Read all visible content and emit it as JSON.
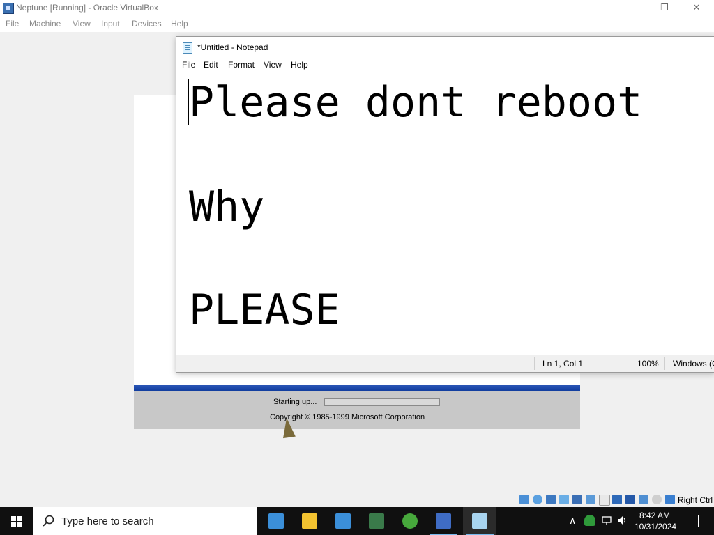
{
  "vbox": {
    "title": "Neptune [Running] - Oracle VirtualBox",
    "window_controls": {
      "minimize": "—",
      "restore": "❐",
      "close": "✕"
    },
    "menu": [
      "File",
      "Machine",
      "View",
      "Input",
      "Devices",
      "Help"
    ],
    "status_icons": [
      "hard-disk-icon",
      "optical-drive-icon",
      "floppy-icon",
      "audio-icon",
      "network-icon",
      "usb-icon",
      "shared-folders-icon",
      "display-icon",
      "recording-icon",
      "cpu-icon",
      "mouse-integration-icon",
      "keyboard-icon"
    ],
    "host_key": "Right Ctrl"
  },
  "splash": {
    "status_text": "Starting up...",
    "progress": 0,
    "copyright": "Copyright © 1985-1999  Microsoft Corporation",
    "bar_color": "#1a47aa"
  },
  "notepad": {
    "title": "*Untitled - Notepad",
    "menu": [
      "File",
      "Edit",
      "Format",
      "View",
      "Help"
    ],
    "lines": [
      "Please dont reboot",
      "Why",
      "PLEASE"
    ],
    "status": {
      "position": "Ln 1, Col 1",
      "zoom": "100%",
      "encoding": "Windows (C"
    }
  },
  "taskbar": {
    "search_placeholder": "Type here to search",
    "apps": [
      {
        "name": "virtualbox-icon",
        "color": "#3b8fd9"
      },
      {
        "name": "file-explorer-icon",
        "color": "#f2c230"
      },
      {
        "name": "virtualbox-icon",
        "color": "#3b8fd9"
      },
      {
        "name": "spreadsheet-icon",
        "color": "#3a7a4a"
      },
      {
        "name": "users-icon",
        "color": "#47a83c"
      },
      {
        "name": "win2000-icon",
        "color": "#3f6cc4"
      },
      {
        "name": "notepad-icon",
        "color": "#a8d4ef"
      }
    ],
    "time": "8:42 AM",
    "date": "10/31/2024"
  }
}
